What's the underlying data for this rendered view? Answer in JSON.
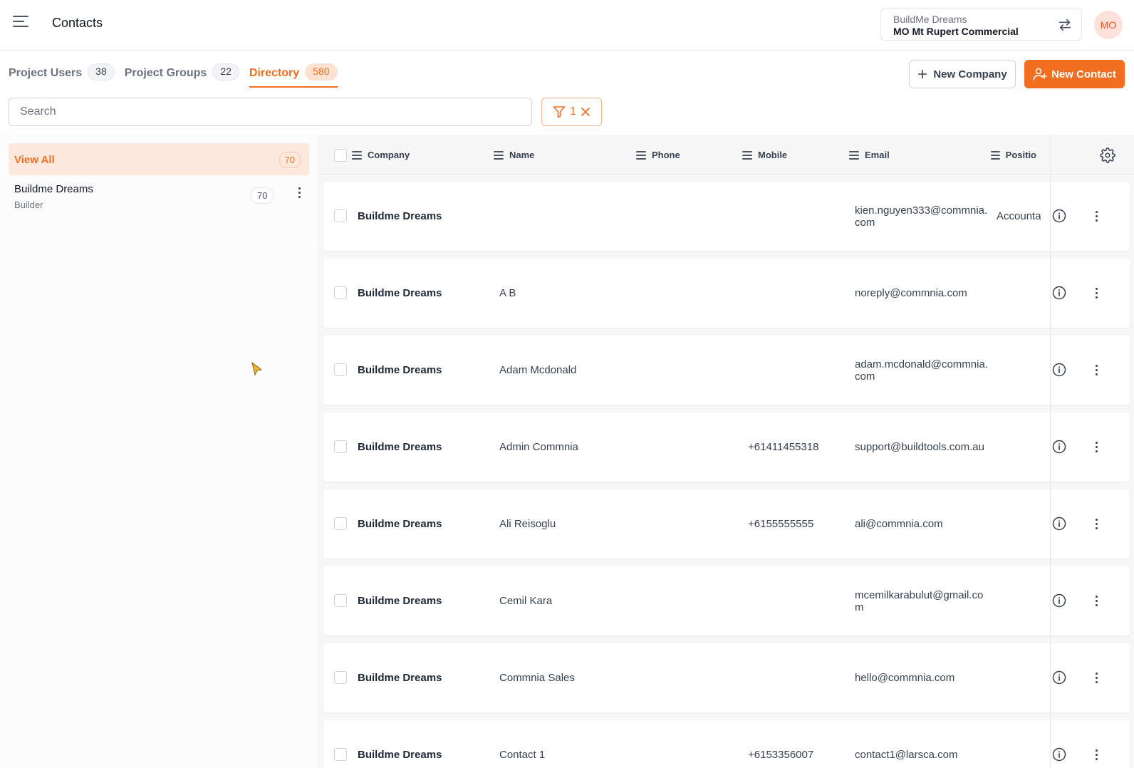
{
  "header": {
    "title": "Contacts",
    "project_switcher": {
      "organization": "BuildMe Dreams",
      "project": "MO Mt Rupert Commercial"
    },
    "avatar_initials": "MO"
  },
  "tabs": [
    {
      "label": "Project Users",
      "count": "38",
      "active": false
    },
    {
      "label": "Project Groups",
      "count": "22",
      "active": false
    },
    {
      "label": "Directory",
      "count": "580",
      "active": true
    }
  ],
  "actions": {
    "new_company_label": "New Company",
    "new_contact_label": "New Contact"
  },
  "search": {
    "placeholder": "Search",
    "value": ""
  },
  "filter": {
    "count": "1"
  },
  "sidebar": {
    "view_all": {
      "label": "View All",
      "count": "70"
    },
    "companies": [
      {
        "name": "Buildme Dreams",
        "type": "Builder",
        "count": "70"
      }
    ]
  },
  "table": {
    "columns": [
      "Company",
      "Name",
      "Phone",
      "Mobile",
      "Email",
      "Positio"
    ],
    "rows": [
      {
        "company": "Buildme Dreams",
        "name": "",
        "phone": "",
        "mobile": "",
        "email": "kien.nguyen333@commnia.com",
        "position": "Accounta"
      },
      {
        "company": "Buildme Dreams",
        "name": "A B",
        "phone": "",
        "mobile": "",
        "email": "noreply@commnia.com",
        "position": ""
      },
      {
        "company": "Buildme Dreams",
        "name": "Adam Mcdonald",
        "phone": "",
        "mobile": "",
        "email": "adam.mcdonald@commnia.com",
        "position": ""
      },
      {
        "company": "Buildme Dreams",
        "name": "Admin Commnia",
        "phone": "",
        "mobile": "+61411455318",
        "email": "support@buildtools.com.au",
        "position": ""
      },
      {
        "company": "Buildme Dreams",
        "name": "Ali Reisoglu",
        "phone": "",
        "mobile": "+6155555555",
        "email": "ali@commnia.com",
        "position": ""
      },
      {
        "company": "Buildme Dreams",
        "name": "Cemil Kara",
        "phone": "",
        "mobile": "",
        "email": "mcemilkarabulut@gmail.com",
        "position": ""
      },
      {
        "company": "Buildme Dreams",
        "name": "Commnia Sales",
        "phone": "",
        "mobile": "",
        "email": "hello@commnia.com",
        "position": ""
      },
      {
        "company": "Buildme Dreams",
        "name": "Contact 1",
        "phone": "",
        "mobile": "+6153356007",
        "email": "contact1@larsca.com",
        "position": ""
      }
    ]
  },
  "colors": {
    "accent": "#f26f21",
    "accent_light": "#fde8dd",
    "avatar_bg": "#fde2dc",
    "avatar_text": "#e4572e"
  },
  "icons": {
    "menu": "hamburger-icon",
    "swap": "swap-arrows-icon",
    "plus": "plus-icon",
    "add_user": "add-user-icon",
    "filter": "filter-icon",
    "close": "close-icon",
    "settings": "gear-icon",
    "info": "info-icon",
    "more": "kebab-icon",
    "column": "column-menu-icon"
  }
}
